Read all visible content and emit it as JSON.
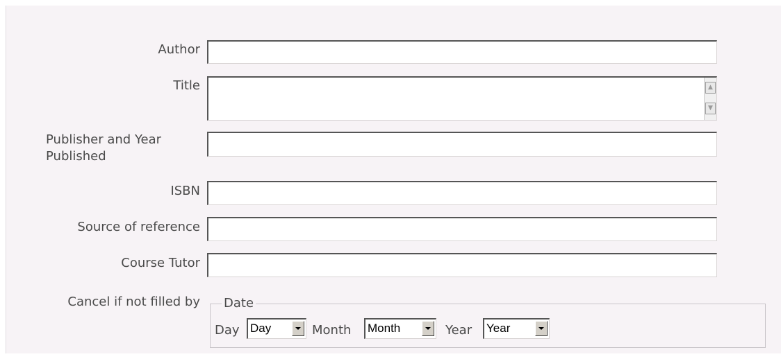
{
  "form": {
    "author": {
      "label": "Author",
      "value": ""
    },
    "title": {
      "label": "Title",
      "value": ""
    },
    "publisher": {
      "label": "Publisher and Year Published",
      "value": ""
    },
    "isbn": {
      "label": "ISBN",
      "value": ""
    },
    "source": {
      "label": "Source of reference",
      "value": ""
    },
    "tutor": {
      "label": "Course Tutor",
      "value": ""
    },
    "cancel": {
      "label": "Cancel if not filled by"
    }
  },
  "date": {
    "legend": "Date",
    "day_label": "Day",
    "day_value": "Day",
    "month_label": "Month",
    "month_value": "Month",
    "year_label": "Year",
    "year_value": "Year"
  },
  "icons": {
    "scroll_up": "scroll-up-arrow-icon",
    "scroll_down": "scroll-down-arrow-icon",
    "dropdown": "dropdown-arrow-icon"
  },
  "colors": {
    "panel_bg": "#f7f3f6",
    "text": "#4a4a4a"
  }
}
